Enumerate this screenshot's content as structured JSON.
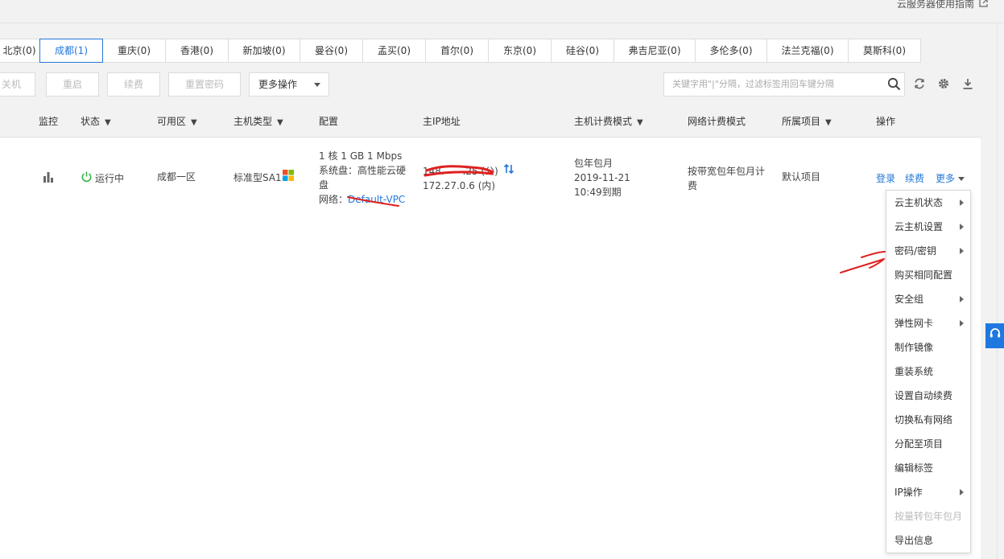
{
  "header": {
    "guide_link": "云服务器使用指南",
    "guide_icon": "external-link-icon"
  },
  "regions": [
    {
      "label": "北京(0)",
      "active": false
    },
    {
      "label": "成都(1)",
      "active": true
    },
    {
      "label": "重庆(0)",
      "active": false
    },
    {
      "label": "香港(0)",
      "active": false
    },
    {
      "label": "新加坡(0)",
      "active": false
    },
    {
      "label": "曼谷(0)",
      "active": false
    },
    {
      "label": "孟买(0)",
      "active": false
    },
    {
      "label": "首尔(0)",
      "active": false
    },
    {
      "label": "东京(0)",
      "active": false
    },
    {
      "label": "硅谷(0)",
      "active": false
    },
    {
      "label": "弗吉尼亚(0)",
      "active": false
    },
    {
      "label": "多伦多(0)",
      "active": false
    },
    {
      "label": "法兰克福(0)",
      "active": false
    },
    {
      "label": "莫斯科(0)",
      "active": false
    }
  ],
  "toolbar": {
    "shutdown": "关机",
    "restart": "重启",
    "renew": "续费",
    "reset_password": "重置密码",
    "more_actions": "更多操作",
    "search_placeholder": "关键字用\"|\"分隔，过滤标签用回车键分隔",
    "icons": [
      "search-icon",
      "refresh-icon",
      "settings-icon",
      "download-icon"
    ]
  },
  "table": {
    "columns": {
      "monitor": "监控",
      "status": "状态",
      "zone": "可用区",
      "host_type": "主机类型",
      "config": "配置",
      "ip": "主IP地址",
      "billing": "主机计费模式",
      "network_billing": "网络计费模式",
      "project": "所属项目",
      "actions": "操作"
    },
    "row": {
      "status": "运行中",
      "zone": "成都一区",
      "host_type": "标准型SA1",
      "config_line1": "1 核 1 GB 1 Mbps",
      "config_line2": "系统盘：高性能云硬盘",
      "config_network_label": "网络：",
      "config_network": "Default-VPC",
      "public_ip": "148.      .25 (公)",
      "private_ip": "172.27.0.6 (内)",
      "billing_line1": "包年包月",
      "billing_line2": "2019-11-21",
      "billing_line3": "10:49到期",
      "network_billing": "按带宽包年包月计费",
      "project": "默认项目",
      "action_login": "登录",
      "action_renew": "续费",
      "action_more": "更多"
    }
  },
  "more_menu": [
    {
      "label": "云主机状态",
      "submenu": true,
      "disabled": false
    },
    {
      "label": "云主机设置",
      "submenu": true,
      "disabled": false
    },
    {
      "label": "密码/密钥",
      "submenu": true,
      "disabled": false
    },
    {
      "label": "购买相同配置",
      "submenu": false,
      "disabled": false
    },
    {
      "label": "安全组",
      "submenu": true,
      "disabled": false
    },
    {
      "label": "弹性网卡",
      "submenu": true,
      "disabled": false
    },
    {
      "label": "制作镜像",
      "submenu": false,
      "disabled": false
    },
    {
      "label": "重装系统",
      "submenu": false,
      "disabled": false
    },
    {
      "label": "设置自动续费",
      "submenu": false,
      "disabled": false
    },
    {
      "label": "切换私有网络",
      "submenu": false,
      "disabled": false
    },
    {
      "label": "分配至项目",
      "submenu": false,
      "disabled": false
    },
    {
      "label": "编辑标签",
      "submenu": false,
      "disabled": false
    },
    {
      "label": "IP操作",
      "submenu": true,
      "disabled": false
    },
    {
      "label": "按量转包年包月",
      "submenu": false,
      "disabled": true
    },
    {
      "label": "导出信息",
      "submenu": false,
      "disabled": false
    }
  ],
  "colors": {
    "accent": "#2277da",
    "running": "#39b54a",
    "annotation": "#e02020"
  }
}
